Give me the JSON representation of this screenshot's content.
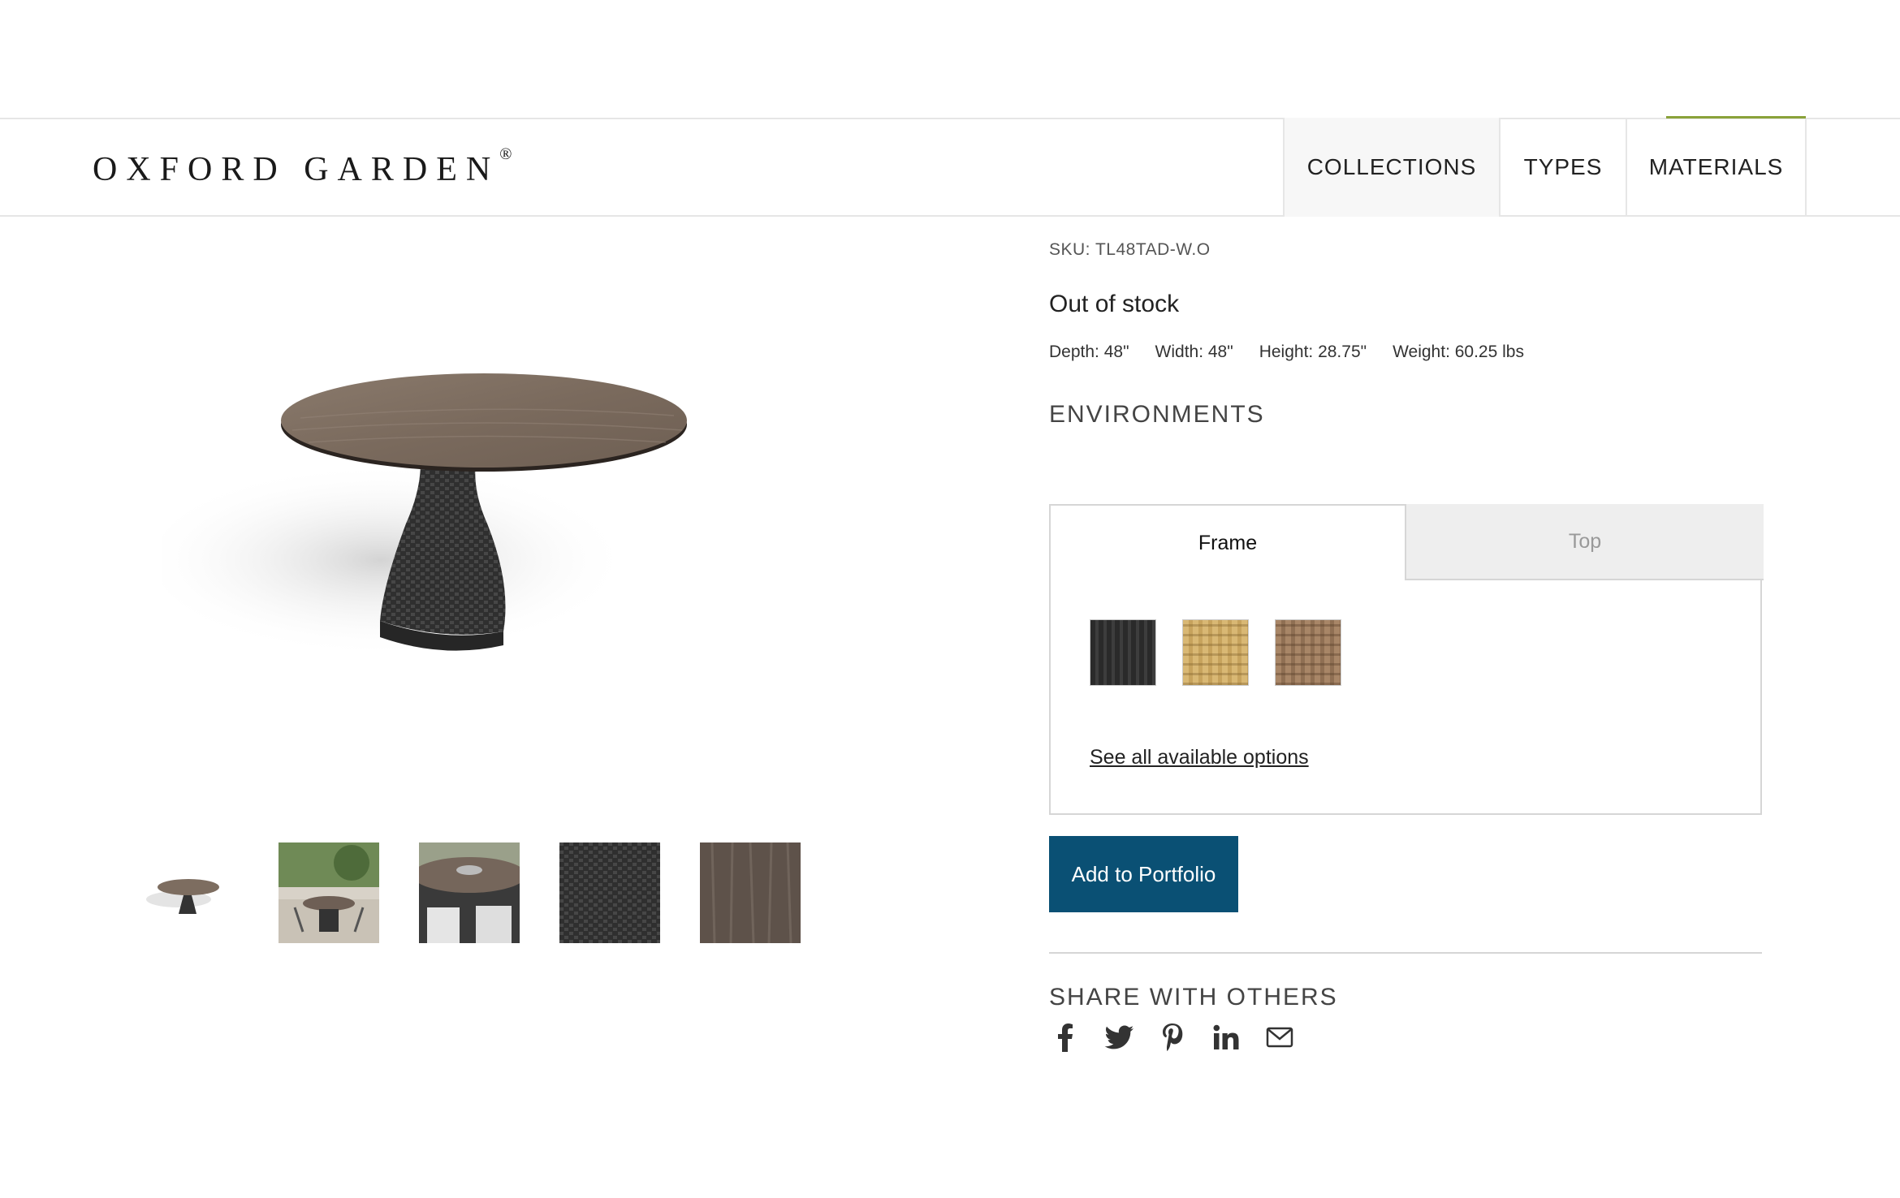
{
  "header": {
    "logo": "OXFORD GARDEN",
    "logo_mark": "®",
    "nav": [
      "COLLECTIONS",
      "TYPES",
      "MATERIALS"
    ],
    "accent_color": "#8aa23a"
  },
  "product": {
    "sku": "SKU: TL48TAD-W.O",
    "stock": "Out of stock",
    "dimensions": {
      "depth": "Depth: 48\"",
      "width": "Width: 48\"",
      "height": "Height: 28.75\"",
      "weight": "Weight: 60.25 lbs"
    },
    "environments_title": "ENVIRONMENTS"
  },
  "options": {
    "tabs": [
      "Frame",
      "Top"
    ],
    "active_tab": "Frame",
    "swatches": [
      "black-wicker-swatch",
      "natural-wicker-swatch",
      "brown-wicker-swatch"
    ],
    "see_all": "See all available options"
  },
  "actions": {
    "add_to_portfolio": "Add to Portfolio",
    "button_color": "#0a5074"
  },
  "share": {
    "title": "SHARE WITH OTHERS",
    "icons": [
      "facebook-icon",
      "twitter-icon",
      "pinterest-icon",
      "linkedin-icon",
      "email-icon"
    ]
  },
  "gallery": {
    "thumbnails": [
      "table-studio-thumb",
      "patio-scene-thumb",
      "table-closeup-thumb",
      "wicker-texture-thumb",
      "wood-top-texture-thumb"
    ]
  }
}
